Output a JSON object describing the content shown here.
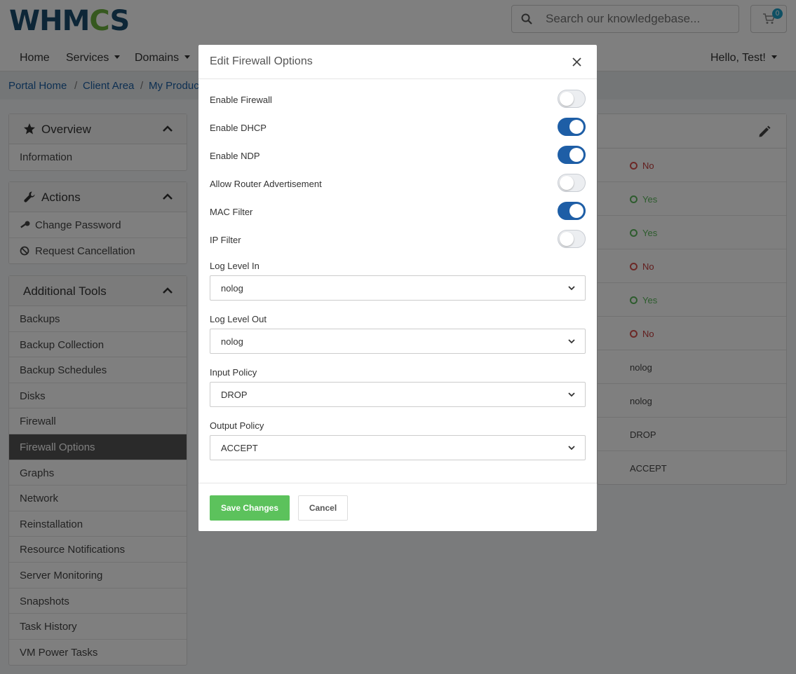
{
  "header": {
    "logo_text": "WHMCS",
    "search_placeholder": "Search our knowledgebase...",
    "cart_count": "0"
  },
  "nav": {
    "home": "Home",
    "services": "Services",
    "domains": "Domains",
    "user_menu": "Hello, Test!"
  },
  "breadcrumb": {
    "items": [
      "Portal Home",
      "Client Area",
      "My Produc"
    ],
    "separator": "/"
  },
  "sidebar": {
    "overview": {
      "title": "Overview",
      "items": [
        "Information"
      ]
    },
    "actions": {
      "title": "Actions",
      "items": [
        "Change Password",
        "Request Cancellation"
      ]
    },
    "tools": {
      "title": "Additional Tools",
      "items": [
        "Backups",
        "Backup Collection",
        "Backup Schedules",
        "Disks",
        "Firewall",
        "Firewall Options",
        "Graphs",
        "Network",
        "Reinstallation",
        "Resource Notifications",
        "Server Monitoring",
        "Snapshots",
        "Task History",
        "VM Power Tasks"
      ],
      "active_item": "Firewall Options"
    }
  },
  "content": {
    "values": [
      "No",
      "Yes",
      "Yes",
      "No",
      "Yes",
      "No",
      "nolog",
      "nolog",
      "DROP",
      "ACCEPT"
    ]
  },
  "modal": {
    "title": "Edit Firewall Options",
    "toggles": [
      {
        "label": "Enable Firewall",
        "on": false
      },
      {
        "label": "Enable DHCP",
        "on": true
      },
      {
        "label": "Enable NDP",
        "on": true
      },
      {
        "label": "Allow Router Advertisement",
        "on": false
      },
      {
        "label": "MAC Filter",
        "on": true
      },
      {
        "label": "IP Filter",
        "on": false
      }
    ],
    "selects": [
      {
        "label": "Log Level In",
        "value": "nolog"
      },
      {
        "label": "Log Level Out",
        "value": "nolog"
      },
      {
        "label": "Input Policy",
        "value": "DROP"
      },
      {
        "label": "Output Policy",
        "value": "ACCEPT"
      }
    ],
    "save_label": "Save Changes",
    "cancel_label": "Cancel"
  },
  "colors": {
    "toggle_on": "#1e5ea6",
    "save_button": "#5cc25c",
    "no_status": "#d9534f",
    "yes_status": "#5cb85c",
    "active_sidebar": "#555555"
  },
  "icons": {
    "search": "search-icon",
    "cart": "cart-icon",
    "overview": "star-icon",
    "actions": "wrench-icon",
    "change_password": "key-icon",
    "request_cancellation": "ban-icon",
    "edit": "pencil-icon",
    "close": "close-icon"
  }
}
